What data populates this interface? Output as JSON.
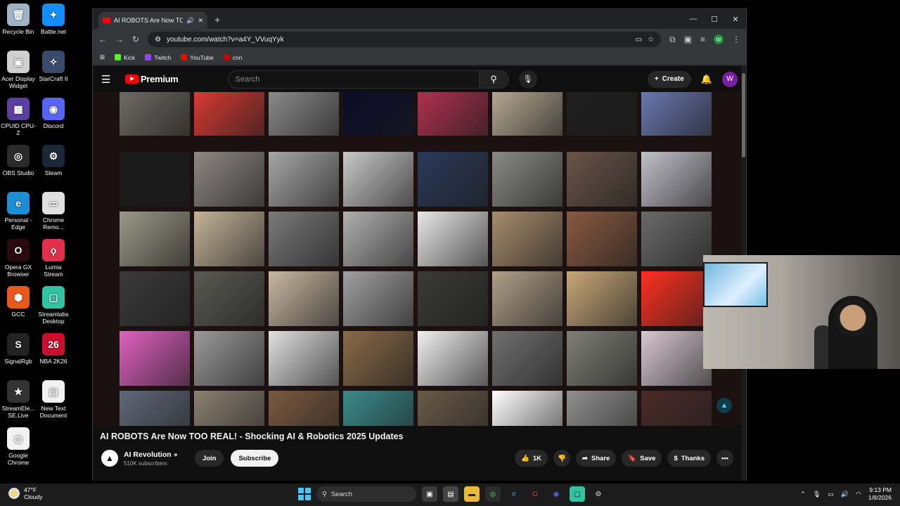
{
  "desktop": {
    "icons": [
      {
        "label": "Recycle Bin",
        "color": "#9fb3c8",
        "glyph": "🗑"
      },
      {
        "label": "Battle.net",
        "color": "#148eff",
        "glyph": "✦"
      },
      {
        "label": "Acer Display Widget",
        "color": "#d0d0d0",
        "glyph": "▣"
      },
      {
        "label": "StarCraft II",
        "color": "#3a4a6a",
        "glyph": "✧"
      },
      {
        "label": "CPUID CPU-Z",
        "color": "#5b3fa0",
        "glyph": "▦"
      },
      {
        "label": "Discord",
        "color": "#5865f2",
        "glyph": "◉"
      },
      {
        "label": "OBS Studio",
        "color": "#2b2b2b",
        "glyph": "◎"
      },
      {
        "label": "Steam",
        "color": "#1b2838",
        "glyph": "⚙"
      },
      {
        "label": "Personal - Edge",
        "color": "#1a8fd8",
        "glyph": "e"
      },
      {
        "label": "Chrome Remo...",
        "color": "#e0e0e0",
        "glyph": "▭"
      },
      {
        "label": "Opera GX Browser",
        "color": "#2a0a10",
        "glyph": "O"
      },
      {
        "label": "Lumia Stream",
        "color": "#e0304a",
        "glyph": "ϙ"
      },
      {
        "label": "GCC",
        "color": "#e8591b",
        "glyph": "⬢"
      },
      {
        "label": "Streamlabs Desktop",
        "color": "#31c3a2",
        "glyph": "▢"
      },
      {
        "label": "SignalRgb",
        "color": "#222",
        "glyph": "S"
      },
      {
        "label": "NBA 2K26",
        "color": "#c8102e",
        "glyph": "26"
      },
      {
        "label": "StreamEle... SE.Live",
        "color": "#333",
        "glyph": "★"
      },
      {
        "label": "New Text Document",
        "color": "#f2f2f2",
        "glyph": "▤"
      },
      {
        "label": "Google Chrome",
        "color": "#f2f2f2",
        "glyph": "◍"
      }
    ]
  },
  "browser": {
    "tab_title": "AI ROBOTS Are Now TOO R",
    "url": "youtube.com/watch?v=a4Y_VVuqYyk",
    "bookmarks": [
      {
        "label": "Kick",
        "color": "#53fc18"
      },
      {
        "label": "Twitch",
        "color": "#9146ff"
      },
      {
        "label": "YouTube",
        "color": "#ff0000"
      },
      {
        "label": "cnn",
        "color": "#cc0000"
      }
    ],
    "profile_initial": "W"
  },
  "youtube": {
    "logo_text": "Premium",
    "search_placeholder": "Search",
    "create_label": "Create",
    "avatar_initial": "W",
    "video_title": "AI ROBOTS Are Now TOO REAL! - Shocking AI & Robotics 2025 Updates",
    "channel_name": "AI Revolution",
    "subscribers": "510K subscribers",
    "join_label": "Join",
    "subscribe_label": "Subscribe",
    "like_count": "1K",
    "share_label": "Share",
    "save_label": "Save",
    "thanks_label": "Thanks",
    "thumb_colors": [
      "#6f6a64",
      "#d93a33",
      "#8a8a8a",
      "#0b0b2a",
      "#b03050",
      "#b4a890",
      "#1e1e1e",
      "#6a78b0",
      "#1a1a1a",
      "#8e8884",
      "#a6a6a6",
      "#c8c8c8",
      "#2a3a5a",
      "#8a8a86",
      "#6a5448",
      "#c0c0c8",
      "#9a9a88",
      "#c4b498",
      "#7a7a7a",
      "#b0b0b0",
      "#e8e8e8",
      "#a88c6c",
      "#8a5a40",
      "#6a6a6a",
      "#3a3a3a",
      "#5a5a54",
      "#c8b8a0",
      "#a0a0a0",
      "#3a3a38",
      "#b0a088",
      "#c8a878",
      "#ff3020",
      "#e060c0",
      "#9a9a9a",
      "#e0e0e0",
      "#8a6a48",
      "#f0f0f0",
      "#707070",
      "#808078",
      "#d8c8d0",
      "#606878",
      "#8a8070",
      "#7a5a40",
      "#3a8a8a",
      "#6a5a48",
      "#ffffff",
      "#909090",
      "#4a2a28"
    ]
  },
  "taskbar": {
    "temperature": "47°F",
    "condition": "Cloudy",
    "search_label": "Search",
    "time": "9:13 PM",
    "date": "1/8/2026"
  }
}
